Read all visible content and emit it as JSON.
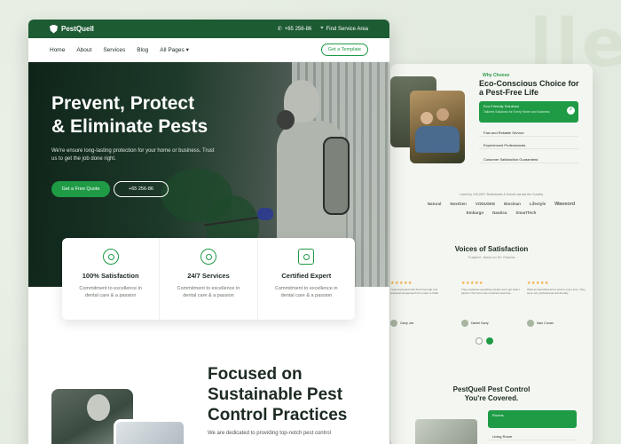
{
  "colors": {
    "brand_green": "#1f9b45",
    "dark_green": "#1d5b33",
    "text": "#1d2a22"
  },
  "topbar": {
    "logo": "PestQuell",
    "phone": "+65 256-86",
    "service_area": "Find Service Area"
  },
  "nav": {
    "items": [
      "Home",
      "About",
      "Services",
      "Blog",
      "All Pages ▾"
    ],
    "cta": "Get a Template"
  },
  "hero": {
    "title_line1": "Prevent, Protect",
    "title_line2": "& Eliminate Pests",
    "text": "We're ensure long-lasting protection for your home or business. Trust us to get the job done right.",
    "quote_button": "Get a Free Quote",
    "phone_button": "+65 256-86"
  },
  "features": [
    {
      "icon": "badge-icon",
      "title": "100% Satisfaction",
      "text": "Commitment to excellence in dental care & a passion"
    },
    {
      "icon": "support-icon",
      "title": "24/7 Services",
      "text": "Commitment to excellence in dental care & a passion"
    },
    {
      "icon": "certificate-icon",
      "title": "Certified Expert",
      "text": "Commitment to excellence in dental care & a passion"
    }
  ],
  "focus": {
    "title": "Focused on Sustainable Pest Control Practices",
    "text": "We are dedicated to providing top-notch pest control"
  },
  "eco": {
    "label": "Why Choose",
    "title": "Eco-Conscious Choice for a Pest-Free Life",
    "items": [
      {
        "label": "Eco-Friendly Solutions",
        "sub": "Tailored Solutions for Every Home and business"
      },
      {
        "label": "Fast and Reliable Service"
      },
      {
        "label": "Experienced Professionals"
      },
      {
        "label": "Customer Satisfaction Guaranteed"
      }
    ]
  },
  "trusted": "Loved by 100,000+ Businesses & Homes across the Country",
  "brands": [
    "Natural",
    "NextGen",
    "VODUSKE",
    "Bioclean",
    "Lifestyle",
    "Waveord",
    "Embargo",
    "Nautica",
    "SmartTech"
  ],
  "testimonials": {
    "title": "Voices of Satisfaction",
    "sub": "Trustpilot  ·  Based on 3k+ Reviews",
    "cards": [
      {
        "stars": "★★★★★",
        "text": "I was impressed with their thorough and professional approach from start to finish.",
        "name": "Garry Joe"
      },
      {
        "stars": "★★★★★",
        "text": "They explained everything clearly and I got what I paid for. My home has remained pest-free.",
        "name": "Daniel Garry"
      },
      {
        "stars": "★★★★★",
        "text": "Work as described and a winner every time. They were very professional and friendly.",
        "name": "Sam Curran"
      }
    ]
  },
  "coverage": {
    "title_line1": "PestQuell Pest Control",
    "title_line2": "You're Covered.",
    "items": [
      "Rooms",
      "Living Room"
    ]
  }
}
